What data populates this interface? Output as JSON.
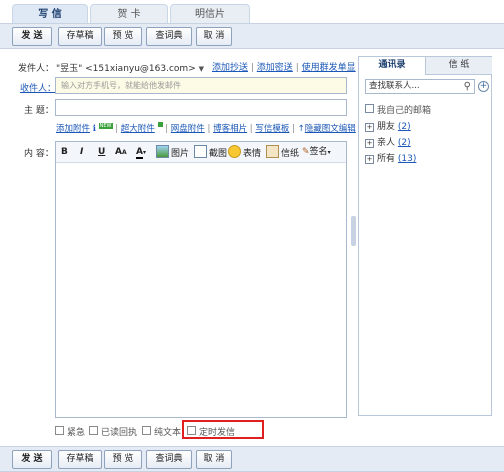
{
  "tabs": [
    {
      "label": "写 信"
    },
    {
      "label": "贺 卡"
    },
    {
      "label": "明信片"
    }
  ],
  "toolbar": {
    "send": "发 送",
    "draft": "存草稿",
    "preview": "预 览",
    "dictionary": "查词典",
    "cancel": "取 消"
  },
  "sender": {
    "label": "发件人：",
    "value": "\"昱玉\" <151xianyu@163.com>",
    "add_cc": "添加抄送",
    "add_bcc": "添加密送",
    "group_send": "使用群发单显"
  },
  "recipient": {
    "label": "收件人：",
    "placeholder": "输入对方手机号，就能给他发邮件"
  },
  "subject": {
    "label": "主  题："
  },
  "attach_links": {
    "add_attachment": "添加附件",
    "new_badge": "NEW",
    "huge_attachment": "超大附件",
    "netdisk_attachment": "网盘附件",
    "blog_photos": "博客相片",
    "letter_template": "写信模板",
    "hide_rich_editor": "隐藏图文编辑"
  },
  "content": {
    "label": "内  容：",
    "tools": {
      "picture": "图片",
      "screenshot": "截图",
      "emoticon": "表情",
      "stationery": "信纸",
      "signature": "签名"
    }
  },
  "options": {
    "urgent": "紧急",
    "read_receipt": "已读回执",
    "plain_text": "纯文本",
    "scheduled": "定时发信"
  },
  "contacts": {
    "tab_contacts": "通讯录",
    "tab_stationery": "信 纸",
    "search_placeholder": "查找联系人...",
    "my_mailbox": "我自己的邮箱",
    "groups": [
      {
        "name": "朋友",
        "count": "(2)"
      },
      {
        "name": "亲人",
        "count": "(2)"
      },
      {
        "name": "所有",
        "count": "(13)"
      }
    ]
  },
  "colors": {
    "highlight_box": "#e02020",
    "link": "#1c58b7",
    "toolbar_bg": "#e4ebf4"
  }
}
